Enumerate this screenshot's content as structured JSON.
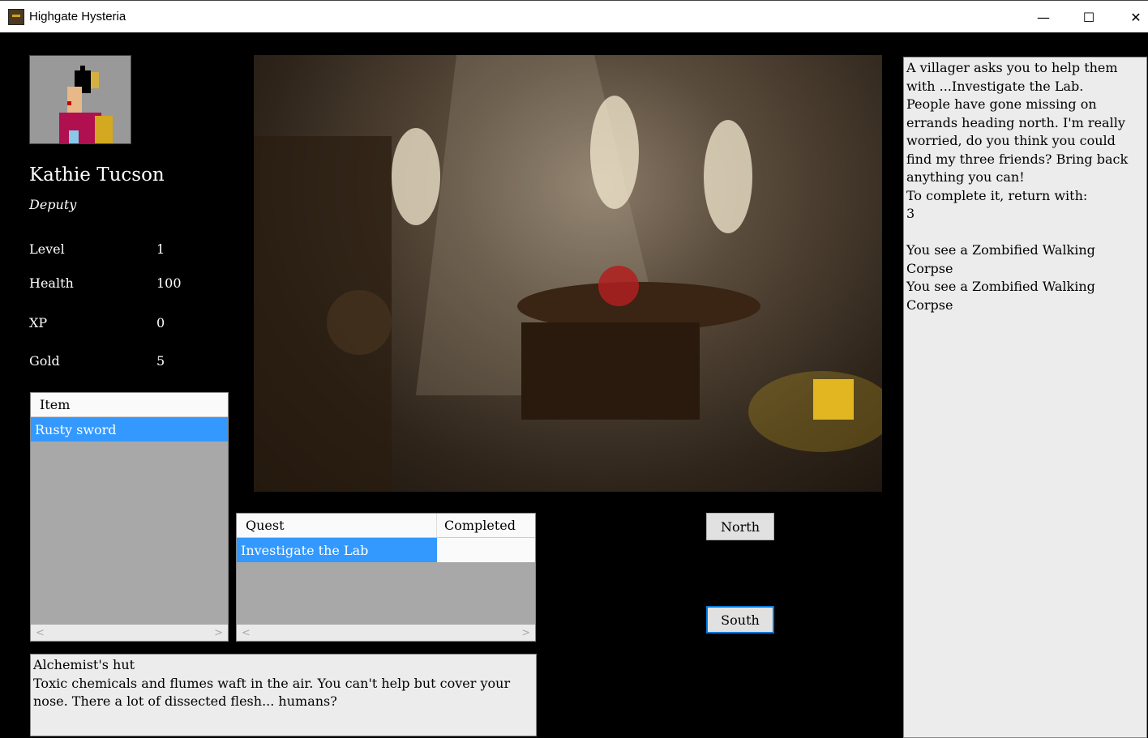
{
  "window": {
    "title": "Highgate Hysteria",
    "icon": "skull-app-icon",
    "controls": [
      "minimize",
      "maximize",
      "close"
    ]
  },
  "player": {
    "name": "Kathie Tucson",
    "role": "Deputy",
    "stats": [
      {
        "label": "Level",
        "value": "1"
      },
      {
        "label": "Health",
        "value": "100"
      },
      {
        "label": "XP",
        "value": "0"
      },
      {
        "label": "Gold",
        "value": "5"
      }
    ]
  },
  "inventory": {
    "header": "Item",
    "items": [
      "Rusty sword"
    ]
  },
  "quests": {
    "headers": [
      "Quest",
      "Completed"
    ],
    "rows": [
      {
        "quest": "Investigate the Lab",
        "completed": ""
      }
    ]
  },
  "navigation": {
    "north": "North",
    "south": "South"
  },
  "location": {
    "name": "Alchemist's hut",
    "description": "Toxic chemicals and flumes waft in the air. You can't help but cover your nose. There a lot of dissected flesh... humans?"
  },
  "messages": [
    "A villager asks you to help them with ...Investigate the Lab.",
    "People have gone missing on errands heading north. I'm really worried, do you think you could find my three friends? Bring back anything you can!",
    "To complete it, return with:",
    "3",
    "",
    "You see a Zombified Walking Corpse",
    "You see a Zombified Walking Corpse"
  ],
  "colors": {
    "selection": "#3399ff",
    "background": "#000000"
  }
}
